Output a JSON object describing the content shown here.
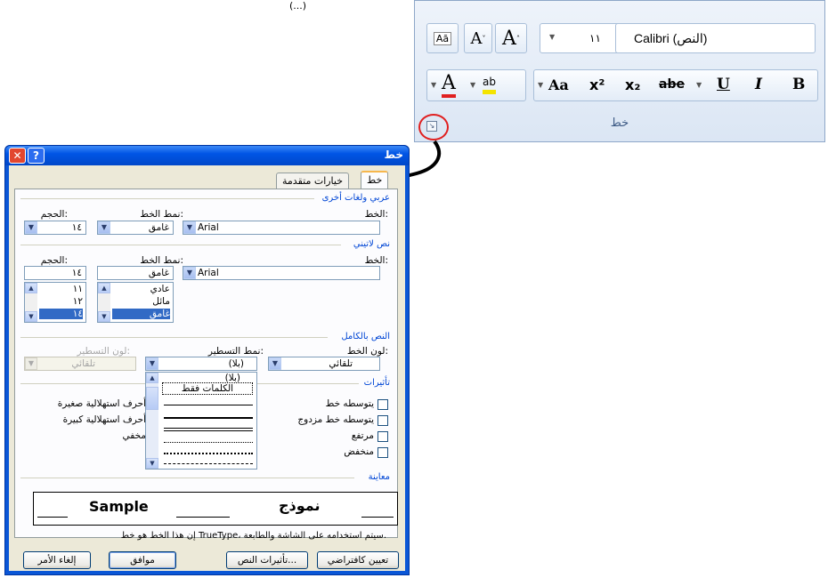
{
  "top_fragment": "(...)",
  "ribbon": {
    "font_name": "Calibri (النص)",
    "font_size": "١١",
    "grow_font_glyph": "A",
    "shrink_font_glyph": "A",
    "clear_format_glyph": "Aā",
    "font_color_glyph": "A",
    "highlight_glyph": "ab",
    "change_case_glyph": "Aa",
    "superscript_glyph": "x²",
    "subscript_glyph": "x₂",
    "strike_glyph": "abe",
    "underline_glyph": "U",
    "italic_glyph": "I",
    "bold_glyph": "B",
    "group_label": "خط",
    "accent": "#e02020"
  },
  "dialog": {
    "title": "خط",
    "help_glyph": "?",
    "close_glyph": "✕",
    "tabs": [
      "خط",
      "خيارات متقدمة"
    ],
    "arabic_section": {
      "title": "عربي ولغات أخرى",
      "font_label": "الخط:",
      "font_value": "Arial",
      "style_label": "نمط الخط:",
      "style_value": "غامق",
      "size_label": "الحجم:",
      "size_value": "١٤"
    },
    "latin_section": {
      "title": "نص لاتيني",
      "font_label": "الخط:",
      "font_value": "Arial",
      "style_label": "نمط الخط:",
      "style_value": "غامق",
      "style_options": [
        "عادي",
        "مائل",
        "غامق"
      ],
      "size_label": "الحجم:",
      "size_value": "١٤",
      "size_options": [
        "١١",
        "١٢",
        "١٤"
      ]
    },
    "complete_text": {
      "title": "النص بالكامل",
      "color_label": "لون الخط:",
      "color_value": "تلقائي",
      "underline_label": "نمط التسطير:",
      "underline_value": "(بلا)",
      "underline_color_label": "لون التسطير:",
      "underline_color_value": "تلقائي",
      "underline_options": [
        "(بلا)",
        "الكلمات فقط"
      ]
    },
    "effects": {
      "title": "تأثيرات",
      "right": [
        "يتوسطه خط",
        "يتوسطه خط مزدوج",
        "مرتفع",
        "منخفض"
      ],
      "left": [
        "أحرف استهلالية صغيرة",
        "أحرف استهلالية كبيرة",
        "مخفي"
      ]
    },
    "preview": {
      "title": "معاينة",
      "sample_arabic": "نموذج",
      "sample_latin": "Sample",
      "note": "إن هذا الخط هو خط TrueType، سيتم استخدامه على الشاشة والطابعة."
    },
    "buttons": {
      "default": "تعيين كافتراضي",
      "text_effects": "تأثيرات النص...",
      "ok": "موافق",
      "cancel": "إلغاء الأمر"
    }
  }
}
